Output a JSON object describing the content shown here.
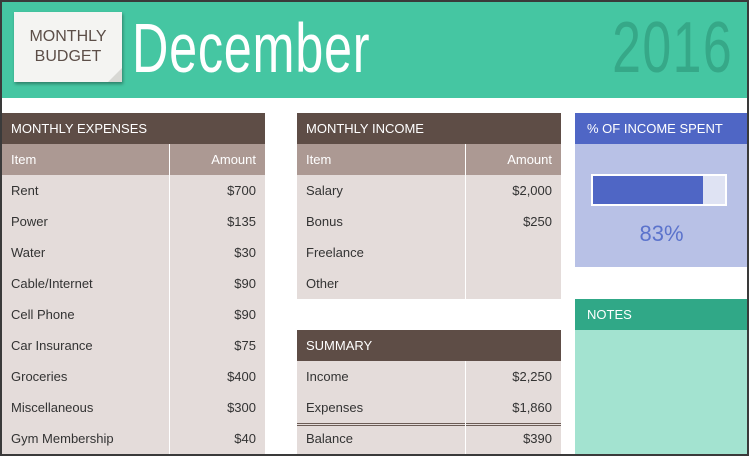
{
  "header": {
    "tag_line1": "MONTHLY",
    "tag_line2": "BUDGET",
    "month": "December",
    "year": "2016"
  },
  "expenses": {
    "title": "MONTHLY EXPENSES",
    "col_item": "Item",
    "col_amount": "Amount",
    "rows": [
      {
        "item": "Rent",
        "amount": "$700"
      },
      {
        "item": "Power",
        "amount": "$135"
      },
      {
        "item": "Water",
        "amount": "$30"
      },
      {
        "item": "Cable/Internet",
        "amount": "$90"
      },
      {
        "item": "Cell Phone",
        "amount": "$90"
      },
      {
        "item": "Car Insurance",
        "amount": "$75"
      },
      {
        "item": "Groceries",
        "amount": "$400"
      },
      {
        "item": "Miscellaneous",
        "amount": "$300"
      },
      {
        "item": "Gym Membership",
        "amount": "$40"
      }
    ]
  },
  "income": {
    "title": "MONTHLY INCOME",
    "col_item": "Item",
    "col_amount": "Amount",
    "rows": [
      {
        "item": "Salary",
        "amount": "$2,000"
      },
      {
        "item": "Bonus",
        "amount": "$250"
      },
      {
        "item": "Freelance",
        "amount": ""
      },
      {
        "item": "Other",
        "amount": ""
      }
    ]
  },
  "summary": {
    "title": "SUMMARY",
    "rows": [
      {
        "item": "Income",
        "amount": "$2,250"
      },
      {
        "item": "Expenses",
        "amount": "$1,860"
      },
      {
        "item": "Balance",
        "amount": "$390"
      }
    ]
  },
  "percent_spent": {
    "title": "% OF INCOME SPENT",
    "value": 0.83,
    "label": "83%",
    "bar_color": "#4f66c5"
  },
  "notes": {
    "title": "NOTES"
  },
  "colors": {
    "header_green": "#45c6a2",
    "table_header_brown": "#5e4d46",
    "table_colhead": "#ac9993",
    "table_body": "#e4dcda"
  }
}
